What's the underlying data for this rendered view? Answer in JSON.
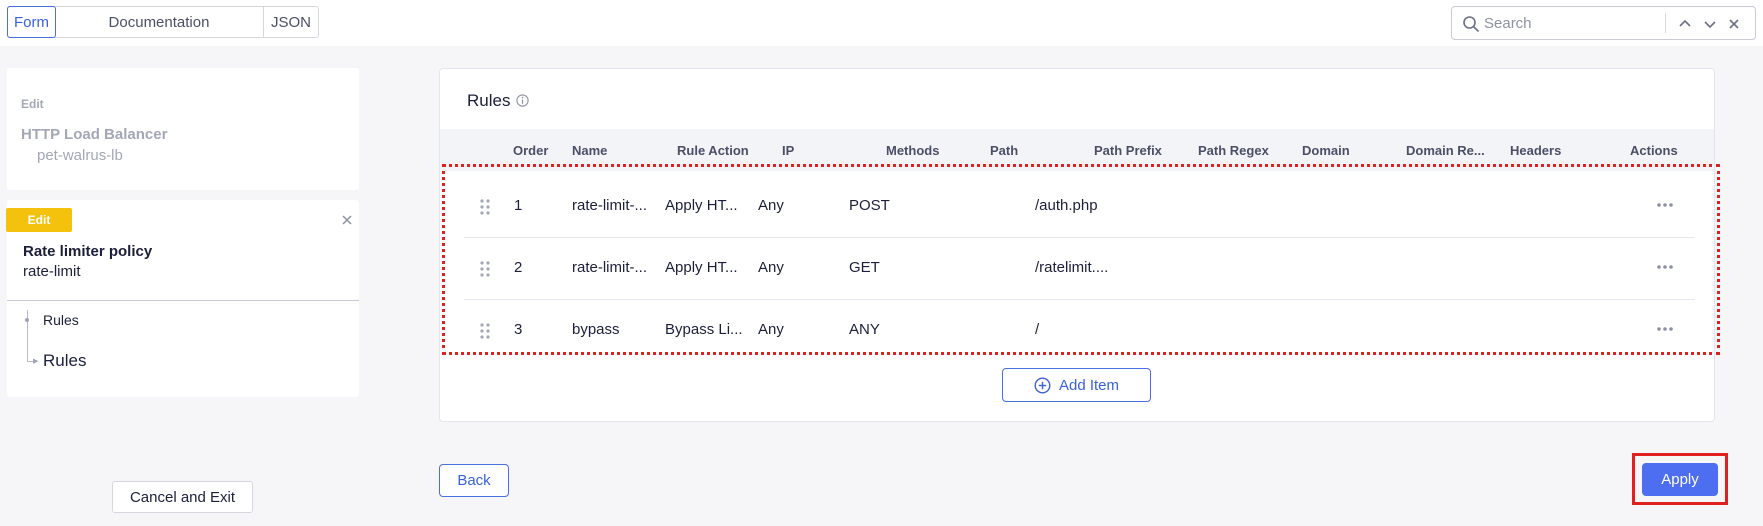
{
  "tabs": [
    {
      "label": "Form",
      "active": true
    },
    {
      "label": "Documentation",
      "active": false
    },
    {
      "label": "JSON",
      "active": false
    }
  ],
  "search": {
    "placeholder": "Search",
    "icon": "search-icon"
  },
  "left": {
    "parent": {
      "edit_label": "Edit",
      "title": "HTTP Load Balancer",
      "subtitle": "pet-walrus-lb"
    },
    "current": {
      "edit_label": "Edit",
      "title": "Rate limiter policy",
      "subtitle": "rate-limit"
    },
    "tree": [
      "Rules",
      "Rules"
    ],
    "cancel_label": "Cancel and Exit"
  },
  "main": {
    "title": "Rules",
    "columns": [
      "Order",
      "Name",
      "Rule Action",
      "IP",
      "Methods",
      "Path",
      "Path Prefix",
      "Path Regex",
      "Domain",
      "Domain Re...",
      "Headers",
      "Actions"
    ],
    "rows": [
      {
        "order": "1",
        "name": "rate-limit-...",
        "action": "Apply HT...",
        "ip": "Any",
        "methods": "POST",
        "path_prefix": "/auth.php"
      },
      {
        "order": "2",
        "name": "rate-limit-...",
        "action": "Apply HT...",
        "ip": "Any",
        "methods": "GET",
        "path_prefix": "/ratelimit...."
      },
      {
        "order": "3",
        "name": "bypass",
        "action": "Bypass Li...",
        "ip": "Any",
        "methods": "ANY",
        "path_prefix": "/"
      }
    ],
    "add_label": "Add Item"
  },
  "footer": {
    "back_label": "Back",
    "apply_label": "Apply"
  },
  "colors": {
    "accent": "#4d6ef0",
    "edit_badge": "#f4c20d",
    "highlight": "#e02020"
  }
}
